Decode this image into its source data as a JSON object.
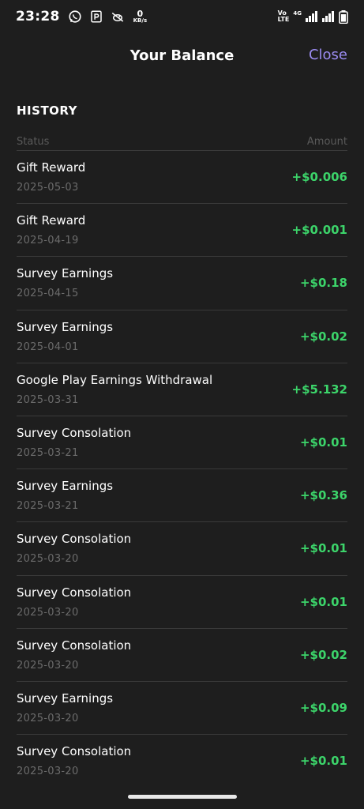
{
  "status_bar": {
    "time": "23:28",
    "net_speed_value": "0",
    "net_speed_unit": "KB/s",
    "volte_line1": "Vo",
    "volte_line2": "LTE",
    "network_type": "4G"
  },
  "header": {
    "title": "Your Balance",
    "close_label": "Close"
  },
  "history": {
    "section_title": "HISTORY",
    "col_status": "Status",
    "col_amount": "Amount",
    "rows": [
      {
        "label": "Gift Reward",
        "date": "2025-05-03",
        "amount": "+$0.006"
      },
      {
        "label": "Gift Reward",
        "date": "2025-04-19",
        "amount": "+$0.001"
      },
      {
        "label": "Survey Earnings",
        "date": "2025-04-15",
        "amount": "+$0.18"
      },
      {
        "label": "Survey Earnings",
        "date": "2025-04-01",
        "amount": "+$0.02"
      },
      {
        "label": "Google Play Earnings Withdrawal",
        "date": "2025-03-31",
        "amount": "+$5.132"
      },
      {
        "label": "Survey Consolation",
        "date": "2025-03-21",
        "amount": "+$0.01"
      },
      {
        "label": "Survey Earnings",
        "date": "2025-03-21",
        "amount": "+$0.36"
      },
      {
        "label": "Survey Consolation",
        "date": "2025-03-20",
        "amount": "+$0.01"
      },
      {
        "label": "Survey Consolation",
        "date": "2025-03-20",
        "amount": "+$0.01"
      },
      {
        "label": "Survey Consolation",
        "date": "2025-03-20",
        "amount": "+$0.02"
      },
      {
        "label": "Survey Earnings",
        "date": "2025-03-20",
        "amount": "+$0.09"
      },
      {
        "label": "Survey Consolation",
        "date": "2025-03-20",
        "amount": "+$0.01"
      }
    ]
  },
  "colors": {
    "background": "#1e1e1e",
    "accent": "#9b8cf2",
    "positive": "#3cd46a",
    "muted": "#6b6b6b"
  }
}
